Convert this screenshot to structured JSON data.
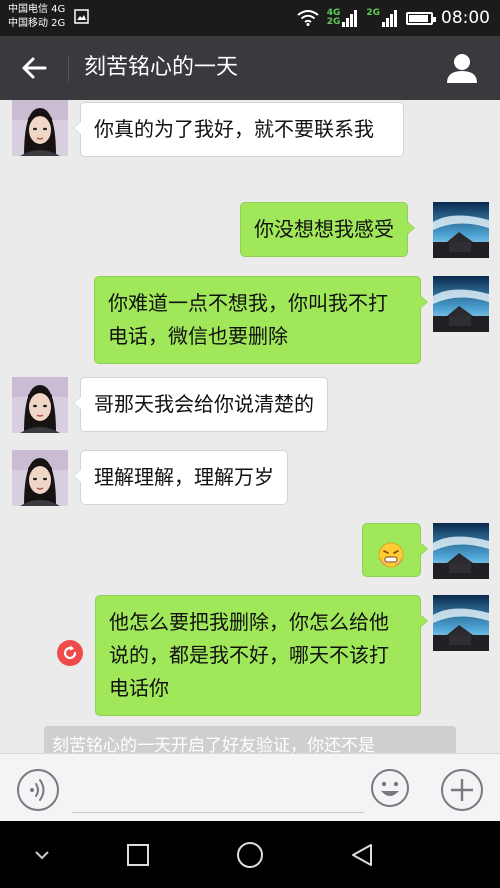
{
  "status_bar": {
    "carrier_1": "中国电信 4G",
    "carrier_2": "中国移动 2G",
    "network_1": "4G",
    "network_2": "2G",
    "network_3": "2G",
    "time": "08:00",
    "battery_level": 0.9
  },
  "header": {
    "title": "刻苦铭心的一天"
  },
  "messages": [
    {
      "side": "left",
      "text": "你真的为了我好，就不要联系我"
    },
    {
      "side": "right",
      "text": "你没想想我感受"
    },
    {
      "side": "right",
      "text": "你难道一点不想我，你叫我不打电话，微信也要删除"
    },
    {
      "side": "left",
      "text": "哥那天我会给你说清楚的"
    },
    {
      "side": "left",
      "text": "理解理解，理解万岁"
    },
    {
      "side": "right",
      "emoji": "grimace-emoji"
    },
    {
      "side": "right",
      "text": "他怎么要把我删除，你怎么给他说的，都是我不好，哪天不该打电话你",
      "failed": true
    }
  ],
  "system_notice": "刻苦铭心的一天开启了好友验证，你还不是",
  "input": {
    "value": ""
  },
  "colors": {
    "bubble_right": "#a0e75a",
    "bubble_left": "#ffffff",
    "title_bar": "#393a3e",
    "resend": "#f04b4b"
  }
}
